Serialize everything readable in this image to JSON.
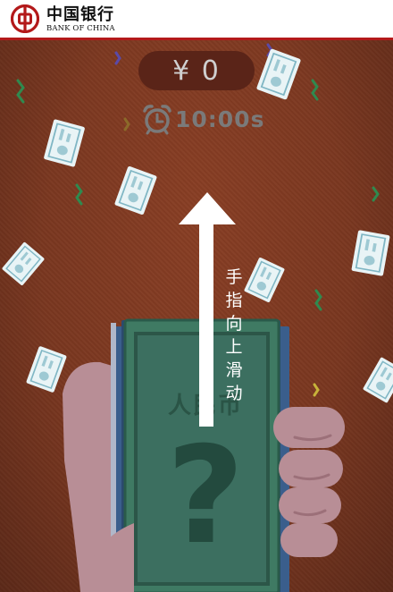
{
  "header": {
    "logo_cn": "中国银行",
    "logo_en": "BANK OF CHINA"
  },
  "game": {
    "money": "¥ 0",
    "timer": "10:00s",
    "instruction": [
      "手",
      "指",
      "向",
      "上",
      "滑",
      "动"
    ],
    "banknote_label": "人民币",
    "banknote_symbol": "?"
  },
  "colors": {
    "brand_red": "#b3191a",
    "background": "#7c3a22",
    "banknote_green": "#3f7a63",
    "hand": "#b88e96"
  },
  "icons": [
    "bank-of-china-logo-icon",
    "alarm-clock-icon",
    "swipe-up-arrow-icon",
    "flying-banknote-icon",
    "confetti-icon"
  ]
}
